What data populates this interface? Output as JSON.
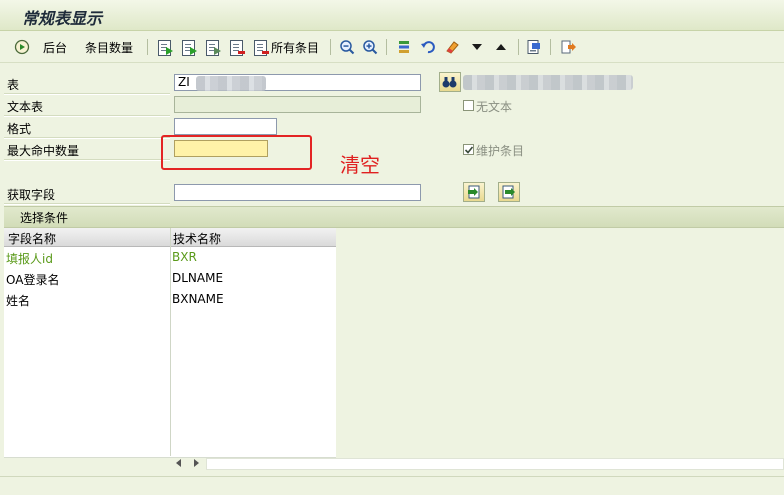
{
  "window": {
    "title": "常规表显示"
  },
  "toolbar": {
    "back_label": "后台",
    "entries_label": "条目数量",
    "all_entries_label": "所有条目"
  },
  "form": {
    "table": {
      "label": "表",
      "value": "ZI"
    },
    "text_table": {
      "label": "文本表",
      "value": ""
    },
    "format": {
      "label": "格式",
      "value": ""
    },
    "max_hits": {
      "label": "最大命中数量",
      "value": ""
    },
    "fetch_fields": {
      "label": "获取字段",
      "value": ""
    },
    "no_text_checkbox": {
      "label": "无文本",
      "checked": false
    },
    "maintain_entries_checkbox": {
      "label": "维护条目",
      "checked": true
    }
  },
  "annotation": {
    "text": "清空",
    "color": "#e02020"
  },
  "selection": {
    "title": "选择条件",
    "columns": [
      "字段名称",
      "技术名称"
    ],
    "rows": [
      {
        "field": "填报人id",
        "tech": "BXR",
        "highlight": true
      },
      {
        "field": "OA登录名",
        "tech": "DLNAME",
        "highlight": false
      },
      {
        "field": "姓名",
        "tech": "BXNAME",
        "highlight": false
      }
    ]
  }
}
